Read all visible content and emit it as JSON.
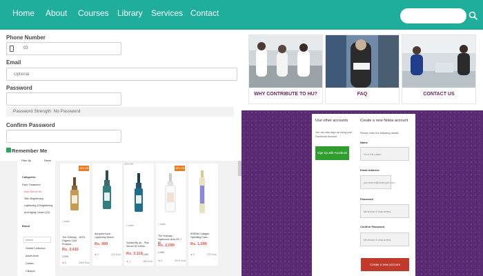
{
  "nav": {
    "links": [
      "Home",
      "About",
      "Courses",
      "Library",
      "Services",
      "Contact"
    ],
    "search_placeholder": "",
    "icon": "search-icon"
  },
  "form": {
    "phone_label": "Phone Number",
    "phone_value": "03",
    "email_label": "Email",
    "email_placeholder": "Optional",
    "password_label": "Password",
    "password_strength": "Password Strength: No Password",
    "confirm_label": "Confirm Password",
    "remember_label": "Remember Me"
  },
  "store": {
    "sidebar": {
      "top_left": "Filter By",
      "top_right": "Reset",
      "categories_heading": "Categories",
      "categories": [
        "Face Treatment",
        "New Serum Kit",
        "Skin Brightening",
        "Lightening & Brightening",
        "Anti Aging Cream (10)"
      ],
      "brand_heading": "Brand",
      "brand_search_placeholder": "Search",
      "brands": [
        "Global Collection",
        "Aadhi Acne",
        "Cetirex",
        "Clinique"
      ]
    },
    "products": [
      {
        "badge": "15% Off",
        "name": "The Ordinary - 100% Organic Cold Pressed...",
        "price": "Rs. 3,415",
        "old": "3,999",
        "rating": "★ 0",
        "meta": "3999 Sold",
        "note": "1 seller"
      },
      {
        "badge": "",
        "name": "Aurapeel Acne Lightening Serum",
        "price": "Rs. 999",
        "old": "",
        "rating": "★ 0",
        "meta": "220 Sold",
        "note": ""
      },
      {
        "badge": "",
        "name": "Solidea By Ali... Plus Serum 30 100ml...",
        "price": "Rs. 3,119",
        "old": "3,969",
        "rating": "★ 1",
        "meta": "285 Sold",
        "note": "1 seller",
        "top_note": "21% Off"
      },
      {
        "badge": "25% Off",
        "name": "The Ordinary - Hyaluronic Acid 2% + B5",
        "price": "Rs. 2,099",
        "old": "2,999",
        "rating": "★ 0",
        "meta": "3975 Sold",
        "note": "1 seller"
      },
      {
        "badge": "",
        "name": "SHENA Collagen Hydrating Face...",
        "price": "Rs. 1,099",
        "old": "",
        "rating": "★ 0",
        "meta": "220 Sold",
        "note": ""
      }
    ]
  },
  "panels": [
    {
      "label": "WHY CONTRIBUTE TO HU?"
    },
    {
      "label": "FAQ"
    },
    {
      "label": "CONTACT US"
    }
  ],
  "nokia": {
    "left_title": "Use other accounts",
    "left_text": "You can also sign up using your Facebook Account.",
    "fb_button": "Sign Up with Facebook",
    "right_title": "Create a new Nokia account",
    "right_text": "Please enter the following details",
    "name_label": "Name",
    "name_placeholder": "Your full name",
    "email_label": "Email Address",
    "email_placeholder": "yourname@example.com",
    "password_label": "Password",
    "password_placeholder": "Minimum 6 characters",
    "confirm_label": "Confirm Password",
    "confirm_placeholder": "Minimum 6 characters",
    "create_button": "Create a new account"
  },
  "colors": {
    "nav": "#1fae9b",
    "panel_label": "#6b1f5e",
    "price": "#e74c3c",
    "purple": "#5a2b73"
  }
}
